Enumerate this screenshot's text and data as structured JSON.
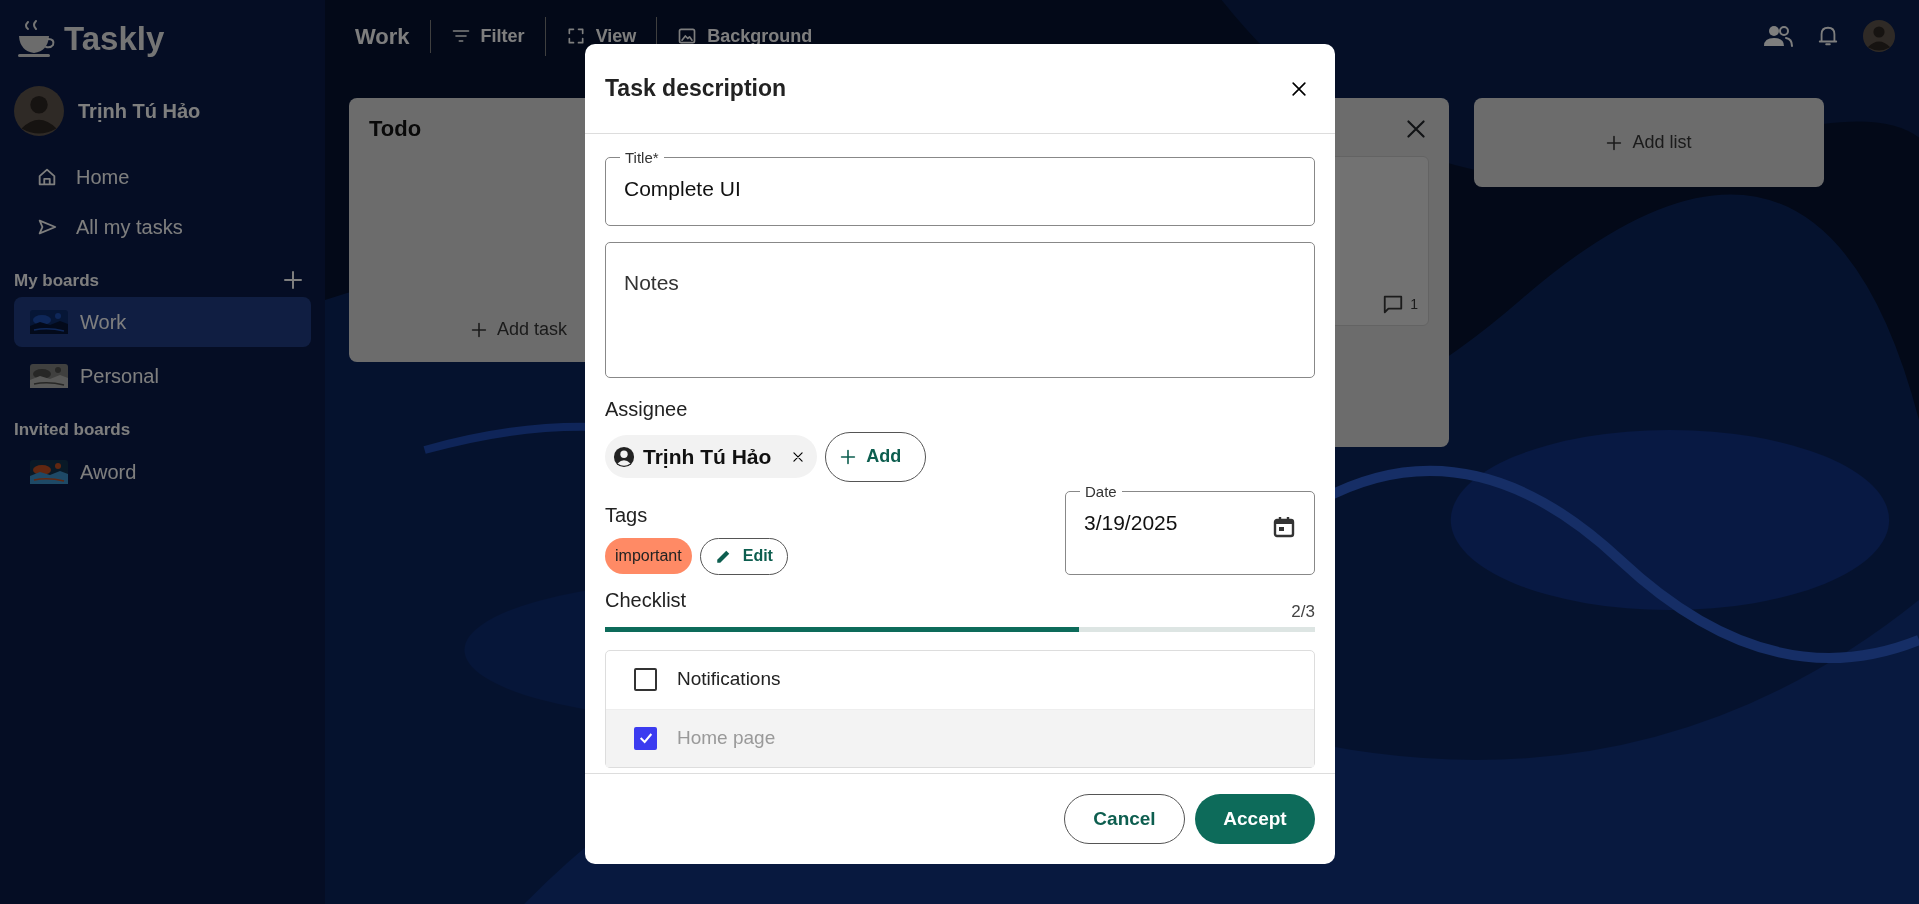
{
  "app": {
    "name": "Taskly"
  },
  "user": {
    "name": "Trịnh Tú Hảo"
  },
  "nav": [
    {
      "label": "Home"
    },
    {
      "label": "All my tasks"
    }
  ],
  "my_boards": {
    "heading": "My boards",
    "items": [
      {
        "label": "Work",
        "selected": true
      },
      {
        "label": "Personal",
        "selected": false
      }
    ]
  },
  "invited_boards": {
    "heading": "Invited boards",
    "items": [
      {
        "label": "Aword",
        "selected": false
      }
    ]
  },
  "toolbar": {
    "board_title": "Work",
    "buttons": [
      "Filter",
      "View",
      "Background"
    ]
  },
  "lists": [
    {
      "title": "Todo",
      "add_task": "Add task"
    },
    {
      "comment_count": "1"
    }
  ],
  "add_list": "Add list",
  "modal": {
    "title": "Task description",
    "title_field": {
      "label": "Title*",
      "value": "Complete UI"
    },
    "notes": {
      "placeholder": "Notes"
    },
    "assignee": {
      "heading": "Assignee",
      "people": [
        "Trịnh Tú Hảo"
      ],
      "add": "Add"
    },
    "tags": {
      "heading": "Tags",
      "items": [
        {
          "label": "important",
          "color": "#ff8a65"
        }
      ],
      "edit": "Edit"
    },
    "date": {
      "label": "Date",
      "value": "3/19/2025"
    },
    "checklist": {
      "heading": "Checklist",
      "reading": "2/3",
      "level": 0.667,
      "items": [
        {
          "label": "Notifications",
          "checked": false
        },
        {
          "label": "Home page",
          "checked": true
        }
      ]
    },
    "buttons": {
      "cancel": "Cancel",
      "accept": "Accept"
    }
  }
}
